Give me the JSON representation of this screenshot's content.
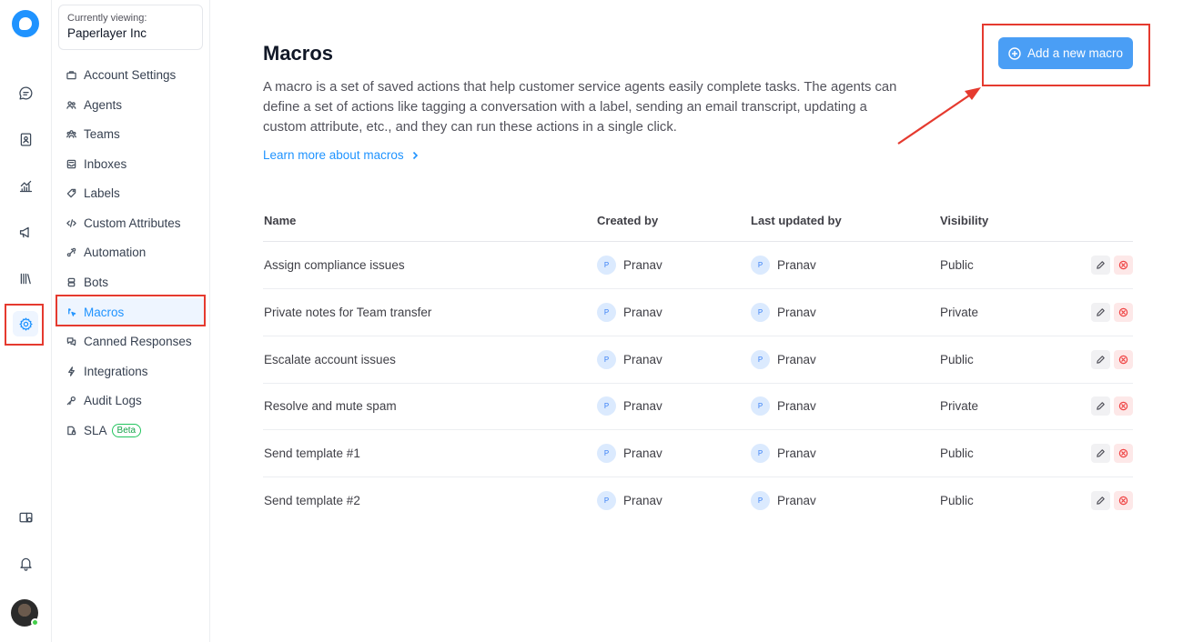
{
  "account": {
    "label": "Currently viewing:",
    "name": "Paperlayer Inc"
  },
  "rail": {
    "top_icons": [
      "logo-icon",
      "conversations-icon",
      "contacts-icon",
      "reports-icon",
      "campaigns-icon",
      "library-icon",
      "settings-icon"
    ],
    "bottom_icons": [
      "dashboard-apps-icon",
      "bell-icon",
      "user-avatar"
    ]
  },
  "sidebar": {
    "items": [
      {
        "label": "Account Settings",
        "icon": "briefcase-icon"
      },
      {
        "label": "Agents",
        "icon": "people-icon"
      },
      {
        "label": "Teams",
        "icon": "team-icon"
      },
      {
        "label": "Inboxes",
        "icon": "inbox-icon"
      },
      {
        "label": "Labels",
        "icon": "tag-icon"
      },
      {
        "label": "Custom Attributes",
        "icon": "code-icon"
      },
      {
        "label": "Automation",
        "icon": "automation-icon"
      },
      {
        "label": "Bots",
        "icon": "bot-icon"
      },
      {
        "label": "Macros",
        "icon": "macro-icon",
        "active": true
      },
      {
        "label": "Canned Responses",
        "icon": "chat-bubbles-icon"
      },
      {
        "label": "Integrations",
        "icon": "flash-icon"
      },
      {
        "label": "Audit Logs",
        "icon": "key-icon"
      },
      {
        "label": "SLA",
        "icon": "document-lock-icon",
        "badge": "Beta"
      }
    ]
  },
  "main": {
    "title": "Macros",
    "description": "A macro is a set of saved actions that help customer service agents easily complete tasks. The agents can define a set of actions like tagging a conversation with a label, sending an email transcript, updating a custom attribute, etc., and they can run these actions in a single click.",
    "learn_more": "Learn more about macros",
    "add_button": "Add a new macro"
  },
  "table": {
    "headers": [
      "Name",
      "Created by",
      "Last updated by",
      "Visibility"
    ],
    "rows": [
      {
        "name": "Assign compliance issues",
        "created_by": "Pranav",
        "updated_by": "Pranav",
        "visibility": "Public"
      },
      {
        "name": "Private notes for Team transfer",
        "created_by": "Pranav",
        "updated_by": "Pranav",
        "visibility": "Private"
      },
      {
        "name": "Escalate account issues",
        "created_by": "Pranav",
        "updated_by": "Pranav",
        "visibility": "Public"
      },
      {
        "name": "Resolve and mute spam",
        "created_by": "Pranav",
        "updated_by": "Pranav",
        "visibility": "Private"
      },
      {
        "name": "Send template #1",
        "created_by": "Pranav",
        "updated_by": "Pranav",
        "visibility": "Public"
      },
      {
        "name": "Send template #2",
        "created_by": "Pranav",
        "updated_by": "Pranav",
        "visibility": "Public"
      }
    ],
    "avatar_initial": "P"
  },
  "colors": {
    "accent": "#1f93ff",
    "button": "#4a9ef5",
    "annotation": "#e53a2f"
  }
}
